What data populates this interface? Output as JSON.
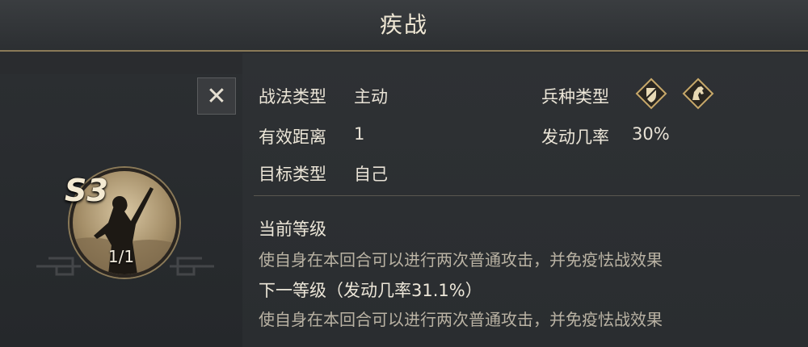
{
  "title": "疾战",
  "close_icon": "close-icon",
  "skill": {
    "grade": "S3",
    "count": "1/1"
  },
  "info": {
    "tactic_type_label": "战法类型",
    "tactic_type_value": "主动",
    "range_label": "有效距离",
    "range_value": "1",
    "target_label": "目标类型",
    "target_value": "自己",
    "troop_type_label": "兵种类型",
    "troop_icons": [
      "shield-troop-icon",
      "cavalry-troop-icon"
    ],
    "trigger_rate_label": "发动几率",
    "trigger_rate_value": "30%"
  },
  "current_level": {
    "title": "当前等级",
    "description": "使自身在本回合可以进行两次普通攻击，并免疫怯战效果"
  },
  "next_level": {
    "title": "下一等级（发动几率31.1%）",
    "description": "使自身在本回合可以进行两次普通攻击，并免疫怯战效果"
  },
  "colors": {
    "background": "#2a2c2f",
    "accent_gold": "#8a7a58",
    "text_primary": "#e8e2d6",
    "text_secondary": "#b9b2a3"
  }
}
